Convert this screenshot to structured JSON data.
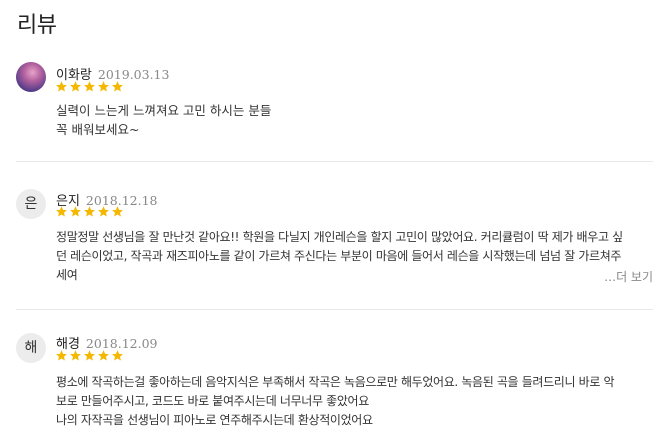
{
  "section": {
    "title": "리뷰"
  },
  "reviews": [
    {
      "avatar_text": "",
      "name": "이화랑",
      "date": "2019.03.13",
      "rating": 5,
      "lines": [
        "실력이 느는게 느껴져요 고민 하시는 분들",
        "꼭 배워보세요~"
      ]
    },
    {
      "avatar_text": "은",
      "name": "은지",
      "date": "2018.12.18",
      "rating": 5,
      "lines": [
        "정말정말 선생님을 잘 만난것 같아요!! 학원을 다닐지 개인레슨을 할지 고민이 많았어요. 커리큘럼이 딱 제가 배우고 싶",
        "던 레슨이었고, 작곡과 재즈피아노를 같이 가르쳐 주신다는 부분이 마음에 들어서 레슨을 시작했는데 넘넘 잘 가르쳐주",
        "세여"
      ],
      "more_label": "…더 보기"
    },
    {
      "avatar_text": "해",
      "name": "해경",
      "date": "2018.12.09",
      "rating": 5,
      "lines": [
        "평소에 작곡하는걸 좋아하는데 음악지식은 부족해서 작곡은 녹음으로만 해두었어요. 녹음된 곡을 들려드리니 바로 악",
        "보로 만들어주시고, 코드도 바로 붙여주시는데 너무너무 좋았어요",
        "나의 자작곡을 선생님이 피아노로 연주해주시는데 환상적이었어요"
      ]
    }
  ],
  "colors": {
    "star": "#f5b800",
    "divider": "#e8e8e8",
    "date": "#888888"
  },
  "icons": {
    "star": "star-icon"
  }
}
